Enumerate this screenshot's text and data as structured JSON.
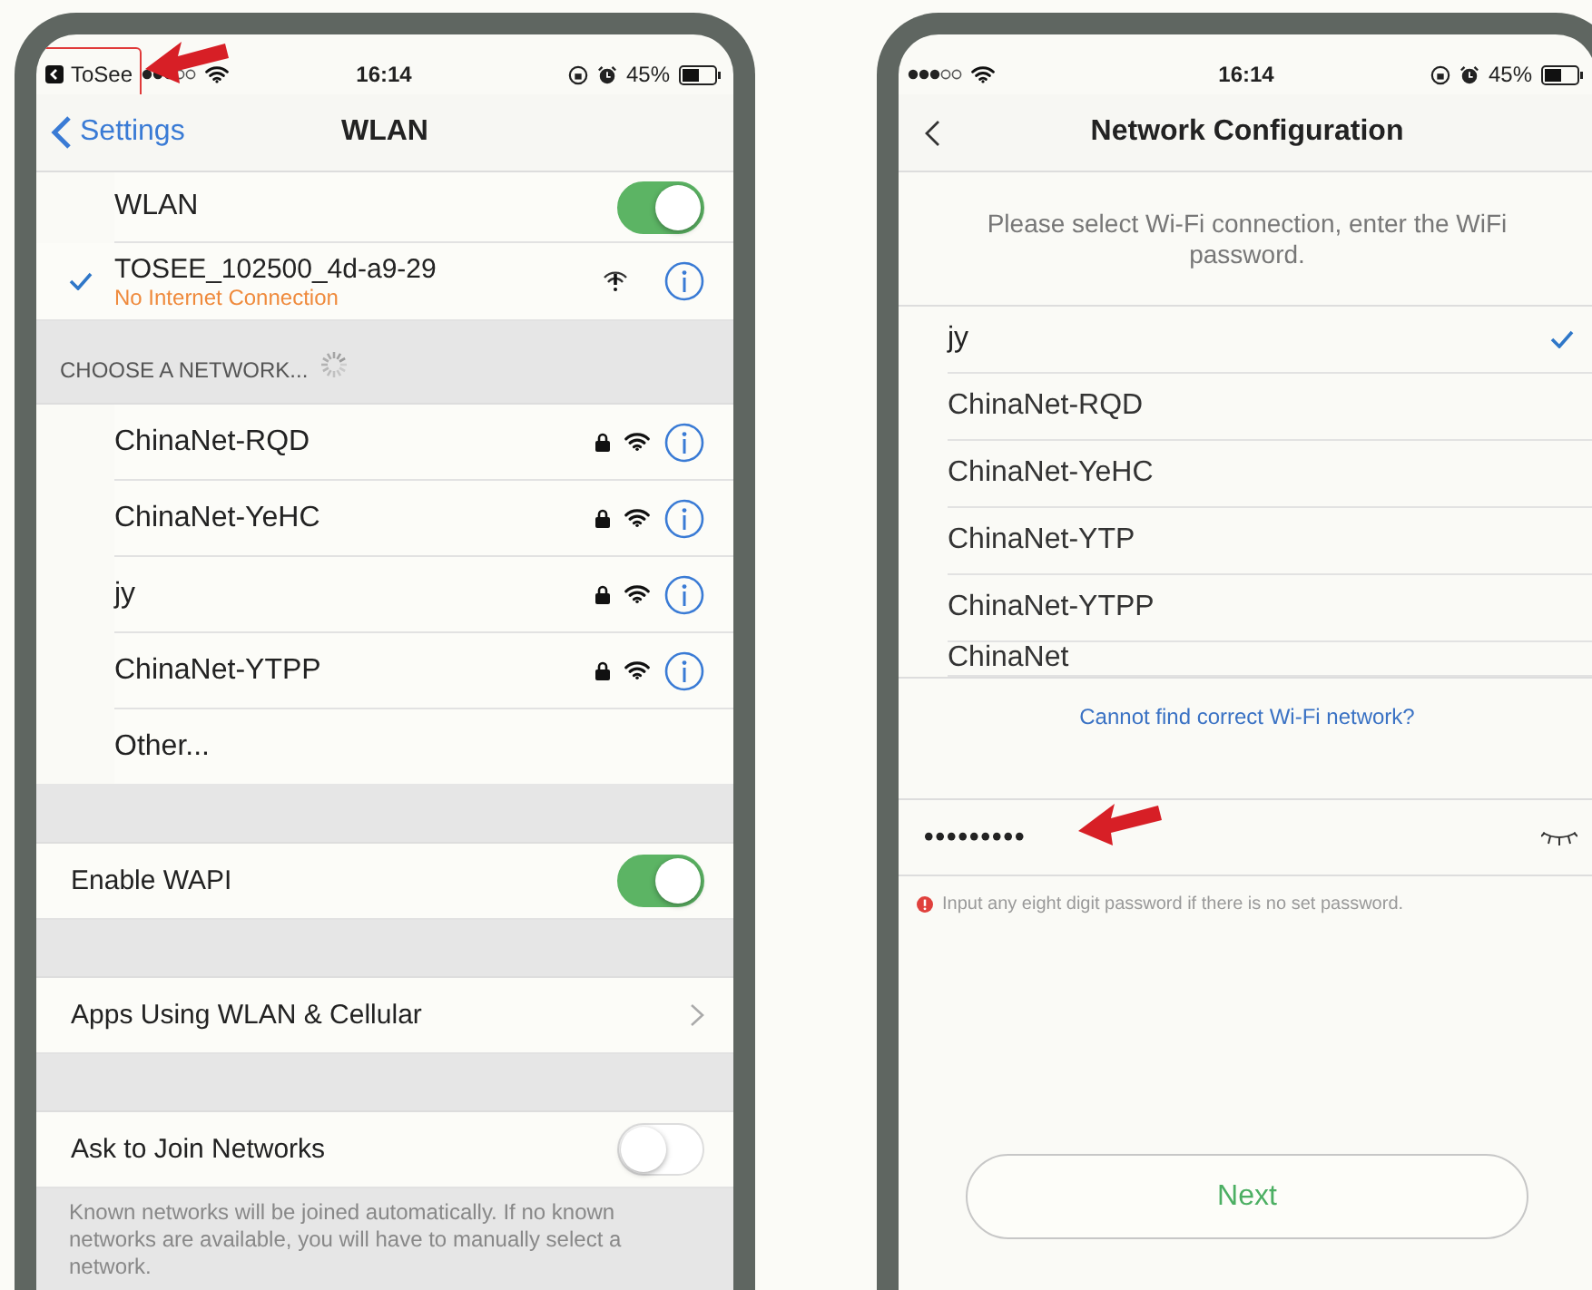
{
  "left_phone": {
    "status_bar": {
      "back_app": "ToSee",
      "time": "16:14",
      "battery": "45%"
    },
    "nav": {
      "back": "Settings",
      "title": "WLAN"
    },
    "wlan": {
      "label": "WLAN",
      "on": true
    },
    "connected": {
      "name": "TOSEE_102500_4d-a9-29",
      "status": "No Internet Connection"
    },
    "section_header": "CHOOSE A NETWORK...",
    "networks": [
      {
        "name": "ChinaNet-RQD"
      },
      {
        "name": "ChinaNet-YeHC"
      },
      {
        "name": "jy"
      },
      {
        "name": "ChinaNet-YTPP"
      }
    ],
    "other": "Other...",
    "settings": [
      {
        "kind": "toggle",
        "label": "Enable WAPI",
        "on": true
      },
      {
        "kind": "link",
        "label": "Apps Using WLAN & Cellular"
      },
      {
        "kind": "toggle",
        "label": "Ask to Join Networks",
        "on": false
      }
    ],
    "footer": "Known networks will be joined automatically. If no known networks are available, you will have to manually select a network."
  },
  "right_phone": {
    "status_bar": {
      "time": "16:14",
      "battery": "45%"
    },
    "title": "Network Configuration",
    "intro": "Please select Wi-Fi connection, enter the WiFi password.",
    "networks": [
      {
        "name": "jy",
        "selected": true
      },
      {
        "name": "ChinaNet-RQD",
        "selected": false
      },
      {
        "name": "ChinaNet-YeHC",
        "selected": false
      },
      {
        "name": "ChinaNet-YTP",
        "selected": false
      },
      {
        "name": "ChinaNet-YTPP",
        "selected": false
      },
      {
        "name": "ChinaNet",
        "selected": false
      }
    ],
    "link": "Cannot find correct Wi-Fi network?",
    "password": {
      "value": "•••••••••"
    },
    "hint": "Input any eight digit password if there is no set password.",
    "button": "Next"
  }
}
